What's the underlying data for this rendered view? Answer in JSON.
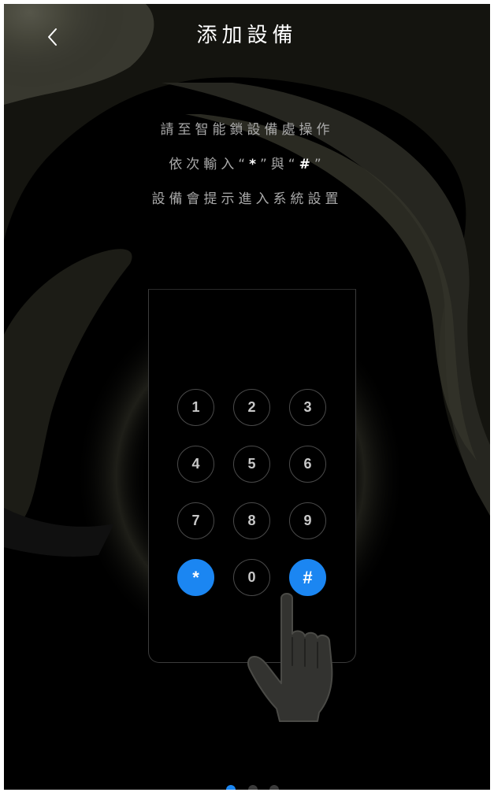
{
  "header": {
    "title": "添加設備",
    "back_icon": "chevron-left-icon"
  },
  "instructions": {
    "line1": "請至智能鎖設備處操作",
    "line2_prefix": "依次輸入“",
    "star": "*",
    "line2_middle": "”與“",
    "hash": "#",
    "line2_suffix": "”",
    "line3": "設備會提示進入系統設置"
  },
  "keypad": {
    "keys": [
      "1",
      "2",
      "3",
      "4",
      "5",
      "6",
      "7",
      "8",
      "9",
      "*",
      "0",
      "#"
    ],
    "highlighted_keys": [
      "*",
      "#"
    ]
  },
  "pager": {
    "count": 3,
    "active_index": 0
  },
  "colors": {
    "accent": "#1b86f2",
    "background": "#000000",
    "title": "#ffffff",
    "instruction_text": "#a9a9a9"
  }
}
